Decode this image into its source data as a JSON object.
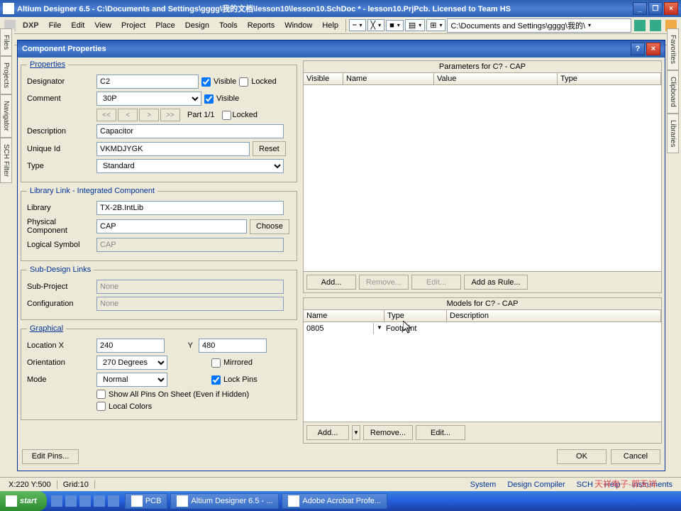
{
  "app": {
    "title": "Altium Designer 6.5 - C:\\Documents and Settings\\gggg\\我的文档\\lesson10\\lesson10.SchDoc * - lesson10.PrjPcb. Licensed to Team HS"
  },
  "menu": {
    "dxp": "DXP",
    "file": "File",
    "edit": "Edit",
    "view": "View",
    "project": "Project",
    "place": "Place",
    "design": "Design",
    "tools": "Tools",
    "reports": "Reports",
    "window": "Window",
    "help": "Help",
    "path_field": "C:\\Documents and Settings\\gggg\\我的\\"
  },
  "sidetabs_left": [
    "Files",
    "Projects",
    "Navigator",
    "SCH Filter"
  ],
  "sidetabs_right": [
    "Favorites",
    "Clipboard",
    "Libraries"
  ],
  "dialog": {
    "title": "Component Properties",
    "properties": {
      "legend": "Properties",
      "designator_label": "Designator",
      "designator": "C2",
      "visible_label": "Visible",
      "locked_label": "Locked",
      "designator_visible": true,
      "designator_locked": false,
      "comment_label": "Comment",
      "comment": "30P",
      "comment_visible": true,
      "nav_prev2": "<<",
      "nav_prev": "<",
      "nav_next": ">",
      "nav_next2": ">>",
      "part_text": "Part 1/1",
      "part_locked": false,
      "description_label": "Description",
      "description": "Capacitor",
      "uniqueid_label": "Unique Id",
      "uniqueid": "VKMDJYGK",
      "reset": "Reset",
      "type_label": "Type",
      "type": "Standard"
    },
    "library": {
      "legend": "Library Link - Integrated Component",
      "library_label": "Library",
      "library": "TX-2B.IntLib",
      "physical_label": "Physical Component",
      "physical": "CAP",
      "choose": "Choose",
      "logical_label": "Logical Symbol",
      "logical": "CAP"
    },
    "subdesign": {
      "legend": "Sub-Design Links",
      "subproject_label": "Sub-Project",
      "subproject": "None",
      "config_label": "Configuration",
      "config": "None"
    },
    "graphical": {
      "legend": "Graphical",
      "locx_label": "Location X",
      "locx": "240",
      "locy_label": "Y",
      "locy": "480",
      "orientation_label": "Orientation",
      "orientation": "270 Degrees",
      "mirrored_label": "Mirrored",
      "mirrored": false,
      "mode_label": "Mode",
      "mode": "Normal",
      "lockpins_label": "Lock Pins",
      "lockpins": true,
      "showallpins_label": "Show All Pins On Sheet (Even if Hidden)",
      "showallpins": false,
      "localcolors_label": "Local Colors",
      "localcolors": false
    },
    "parameters": {
      "title": "Parameters for C? - CAP",
      "col_visible": "Visible",
      "col_name": "Name",
      "col_value": "Value",
      "col_type": "Type",
      "add": "Add...",
      "remove": "Remove...",
      "edit": "Edit...",
      "addrule": "Add as Rule..."
    },
    "models": {
      "title": "Models for C? - CAP",
      "col_name": "Name",
      "col_type": "Type",
      "col_desc": "Description",
      "row1_name": "0805",
      "row1_type": "Footprint",
      "row1_desc": "",
      "add": "Add...",
      "remove": "Remove...",
      "edit": "Edit..."
    },
    "editpins": "Edit Pins...",
    "ok": "OK",
    "cancel": "Cancel"
  },
  "statusbar": {
    "coords": "X:220 Y:500",
    "grid": "Grid:10",
    "tabs": {
      "system": "System",
      "dc": "Design Compiler",
      "sch": "SCH",
      "help": "Help",
      "inst": "Instruments"
    }
  },
  "taskbar": {
    "start": "start",
    "btn1": "PCB",
    "btn2": "Altium Designer 6.5 - ...",
    "btn3": "Adobe Acrobat Profe..."
  },
  "watermark": "天祥电子-郭天祥"
}
